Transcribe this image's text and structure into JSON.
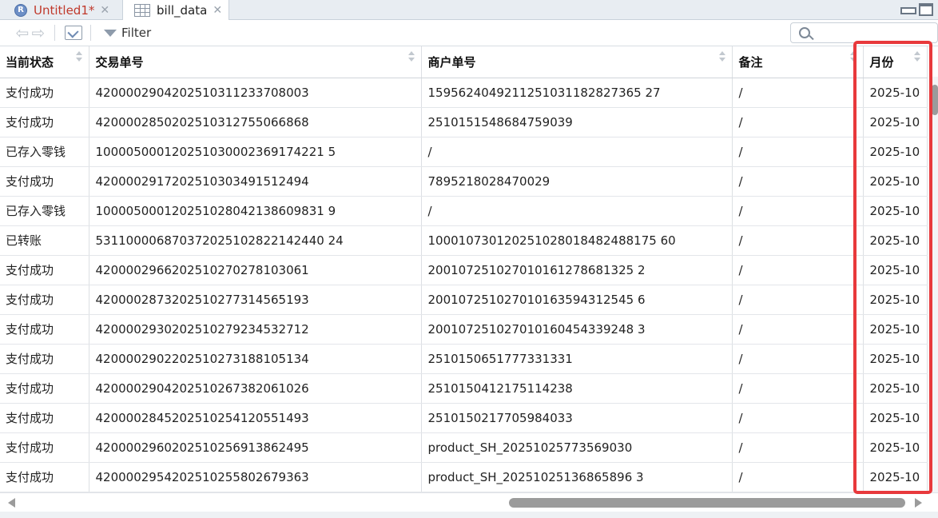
{
  "tabs": [
    {
      "label": "Untitled1*",
      "icon": "r-file-icon"
    },
    {
      "label": "bill_data",
      "icon": "grid-icon"
    }
  ],
  "toolbar": {
    "filter_label": "Filter",
    "search_placeholder": ""
  },
  "table": {
    "columns": [
      "当前状态",
      "交易单号",
      "商户单号",
      "备注",
      "月份"
    ],
    "rows": [
      [
        "支付成功",
        "4200002904202510311233708003",
        "1595624049211251031182827365 27",
        "/",
        "2025-10"
      ],
      [
        "支付成功",
        "4200002850202510312755066868",
        "2510151548684759039",
        "/",
        "2025-10"
      ],
      [
        "已存入零钱",
        "100005000120251030002369174221 5",
        "/",
        "/",
        "2025-10"
      ],
      [
        "支付成功",
        "4200002917202510303491512494",
        "7895218028470029",
        "/",
        "2025-10"
      ],
      [
        "已存入零钱",
        "100005000120251028042138609831 9",
        "/",
        "/",
        "2025-10"
      ],
      [
        "已转账",
        "531100006870372025102822142440 24",
        "100010730120251028018482488175 60",
        "/",
        "2025-10"
      ],
      [
        "支付成功",
        "4200002966202510270278103061",
        "200107251027010161278681325 2",
        "/",
        "2025-10"
      ],
      [
        "支付成功",
        "4200002873202510277314565193",
        "200107251027010163594312545 6",
        "/",
        "2025-10"
      ],
      [
        "支付成功",
        "4200002930202510279234532712",
        "200107251027010160454339248 3",
        "/",
        "2025-10"
      ],
      [
        "支付成功",
        "4200002902202510273188105134",
        "2510150651777331331",
        "/",
        "2025-10"
      ],
      [
        "支付成功",
        "4200002904202510267382061026",
        "2510150412175114238",
        "/",
        "2025-10"
      ],
      [
        "支付成功",
        "4200002845202510254120551493",
        "2510150217705984033",
        "/",
        "2025-10"
      ],
      [
        "支付成功",
        "4200002960202510256913862495",
        "product_SH_20251025773569030",
        "/",
        "2025-10"
      ],
      [
        "支付成功",
        "4200002954202510255802679363",
        "product_SH_20251025136865896 3",
        "/",
        "2025-10"
      ]
    ]
  },
  "colors": {
    "highlight": "#e8393c",
    "tab_modified": "#c0392b"
  }
}
